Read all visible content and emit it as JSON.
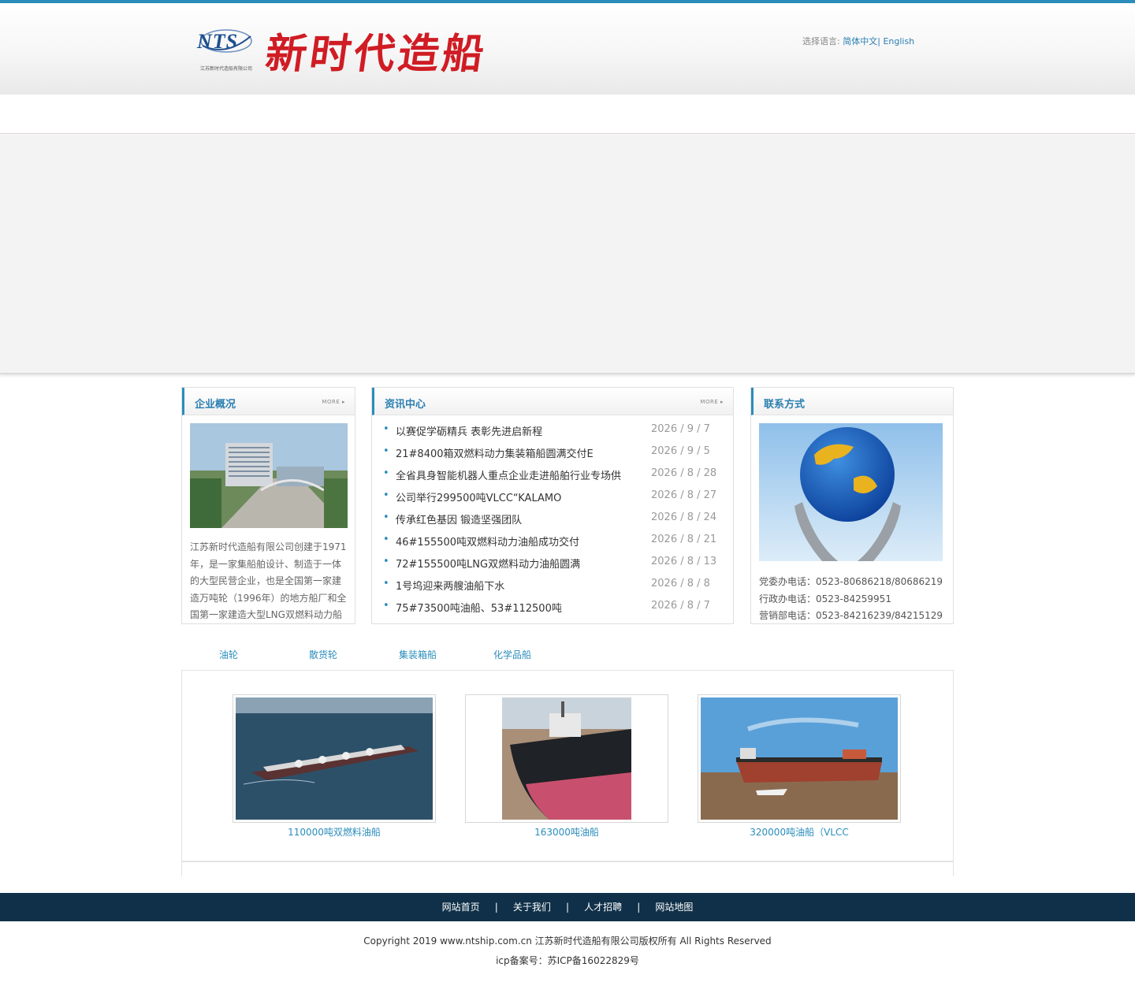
{
  "header": {
    "logo_text": "NTS",
    "logo_subtitle": "江苏新时代造船有限公司",
    "brand_title": "新时代造船",
    "lang_label": "选择语言:",
    "lang_cn": "简体中文",
    "lang_sep": "|",
    "lang_en": "English"
  },
  "sections": {
    "about": {
      "title": "企业概况",
      "more": "MORE",
      "intro": "江苏新时代造船有限公司创建于1971年，是一家集船舶设计、制造于一体的大型民营企业，也是全国第一家建造万吨轮（1996年）的地方船厂和全国第一家建造大型LNG双燃料动力船"
    },
    "news": {
      "title": "资讯中心",
      "more": "MORE",
      "items": [
        {
          "title": "以赛促学砺精兵 表彰先进启新程",
          "date": "2026 / 9 / 7"
        },
        {
          "title": "21#8400箱双燃料动力集装箱船圆满交付E",
          "date": "2026 / 9 / 5"
        },
        {
          "title": "全省具身智能机器人重点企业走进船舶行业专场供",
          "date": "2026 / 8 / 28"
        },
        {
          "title": "公司举行299500吨VLCC“KALAMO",
          "date": "2026 / 8 / 27"
        },
        {
          "title": "传承红色基因 锻造坚强团队",
          "date": "2026 / 8 / 24"
        },
        {
          "title": "46#155500吨双燃料动力油船成功交付",
          "date": "2026 / 8 / 21"
        },
        {
          "title": "72#155500吨LNG双燃料动力油船圆满",
          "date": "2026 / 8 / 13"
        },
        {
          "title": "1号坞迎来两艘油船下水",
          "date": "2026 / 8 / 8"
        },
        {
          "title": "75#73500吨油船、53#112500吨",
          "date": "2026 / 8 / 7"
        }
      ]
    },
    "contact": {
      "title": "联系方式",
      "lines": [
        "党委办电话：0523-80686218/80686219",
        "行政办电话：0523-84259951",
        "营销部电话：0523-84216239/84215129"
      ]
    }
  },
  "product_tabs": [
    "油轮",
    "散货轮",
    "集装箱船",
    "化学品船"
  ],
  "products": [
    {
      "caption": "110000吨双燃料油船"
    },
    {
      "caption": "163000吨油船"
    },
    {
      "caption": "320000吨油船（VLCC"
    }
  ],
  "footer": {
    "links": [
      "网站首页",
      "关于我们",
      "人才招聘",
      "网站地图"
    ],
    "sep": "|",
    "copyright": "Copyright 2019 www.ntship.com.cn 江苏新时代造船有限公司版权所有 All Rights Reserved",
    "icp": "icp备案号：苏ICP备16022829号"
  }
}
